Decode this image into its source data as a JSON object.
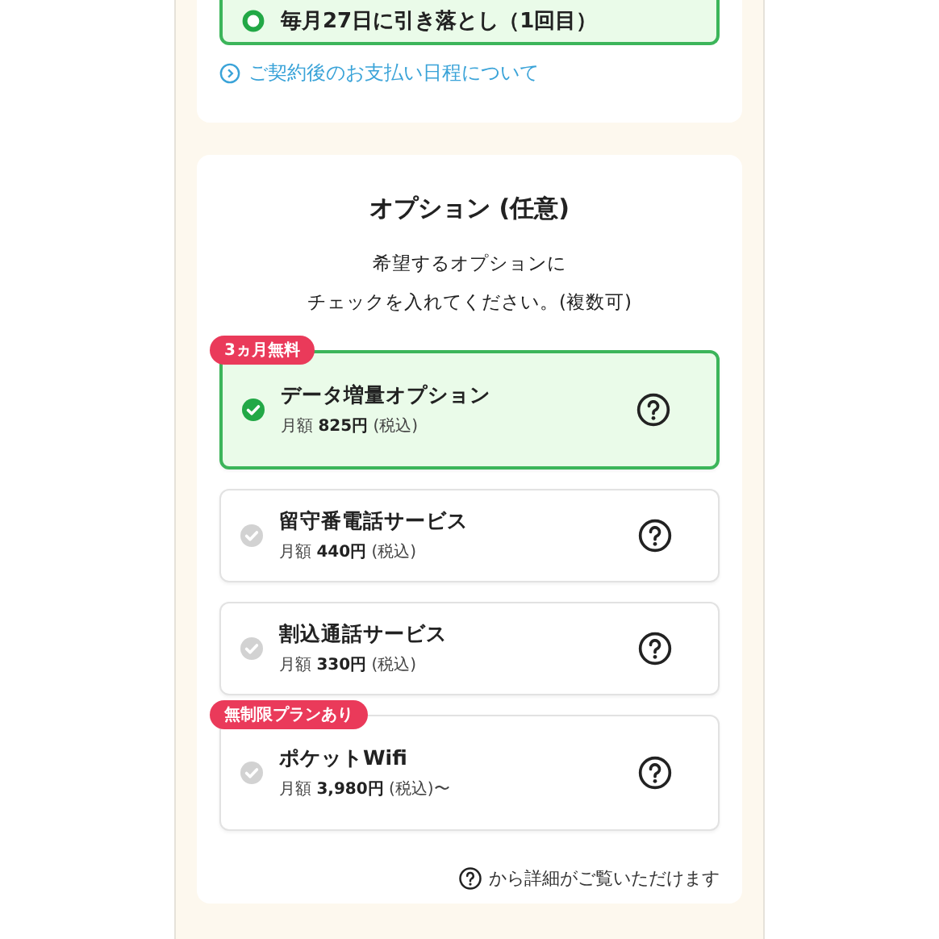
{
  "payment_card": {
    "selected_schedule": {
      "label": "毎月27日に引き落とし（1回目）",
      "selected": true
    },
    "link": "ご契約後のお支払い日程について"
  },
  "options_card": {
    "title": "オプション (任意)",
    "description_lines": [
      "希望するオプションに",
      "チェックを入れてください。(複数可)"
    ],
    "options": [
      {
        "badge": "3ヵ月無料",
        "name": "データ増量オプション",
        "price_label": "月額",
        "price": "825円",
        "tax_note": "(税込)",
        "checked": true
      },
      {
        "name": "留守番電話サービス",
        "price_label": "月額",
        "price": "440円",
        "tax_note": "(税込)",
        "checked": false
      },
      {
        "name": "割込通話サービス",
        "price_label": "月額",
        "price": "330円",
        "tax_note": "(税込)",
        "checked": false
      },
      {
        "badge": "無制限プランあり",
        "name": "ポケットWifi",
        "price_label": "月額",
        "price": "3,980円",
        "tax_note": "(税込)〜",
        "checked": false
      }
    ],
    "footnote": "から詳細がご覧いただけます"
  }
}
